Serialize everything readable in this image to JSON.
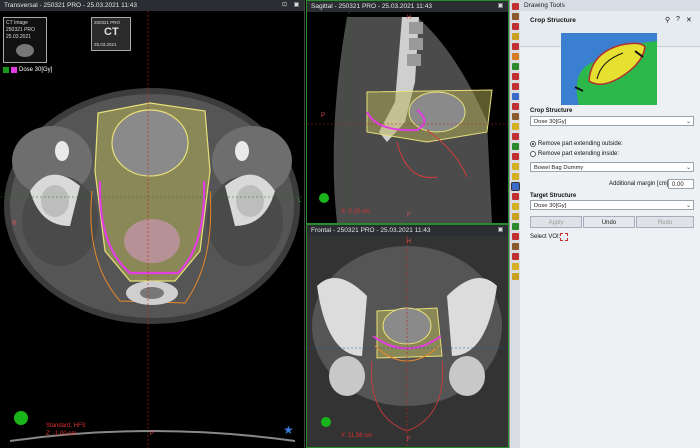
{
  "transversal": {
    "title": "Transversal - 250321 PRO - 25.03.2021 11:43",
    "thumb1": {
      "line1": "CT Image",
      "line2": "250321 PRO",
      "line3": "25.03.2021"
    },
    "thumb2": {
      "line1": "250321 PRO",
      "line2": "25.03.2021",
      "badge": "CT"
    },
    "dose_label": "Dose 30[Gy]",
    "orient_left": "R",
    "orient_bottom": "P",
    "marker_l": "L",
    "status_line1": "Standard, HFS",
    "status_line2": "Z: -1.00 cm"
  },
  "sagittal": {
    "title": "Sagittal - 250321 PRO - 25.03.2021 11:43",
    "orient_top": "H",
    "orient_left": "P",
    "orient_bottom": "F",
    "coord": "X: 0.10 cm"
  },
  "frontal": {
    "title": "Frontal - 250321 PRO - 25.03.2021 11:43",
    "orient_top": "H",
    "orient_bottom": "F",
    "coord": "Y: 11.56 cm"
  },
  "panel": {
    "title": "Drawing Tools",
    "section_title": "Crop Structure",
    "crop_structure_label": "Crop Structure",
    "crop_structure_value": "Dose 30[Gy]",
    "radio_outside": "Remove part extending outside:",
    "radio_inside": "Remove part extending inside:",
    "inside_value": "Bowel Bag Dummy",
    "margin_label": "Additional margin [cm]",
    "margin_value": "0.00",
    "target_structure_label": "Target Structure",
    "target_structure_value": "Dose 30[Gy]",
    "apply_label": "Apply",
    "undo_label": "Undo",
    "redo_label": "Redo",
    "select_voi_label": "Select VOI:"
  },
  "colors": {
    "dose": "#e23de2",
    "yellow": "#e8e07a",
    "orange": "#e8882a",
    "red_contour": "#d83a3a",
    "green_frame": "#2a8b2a"
  }
}
